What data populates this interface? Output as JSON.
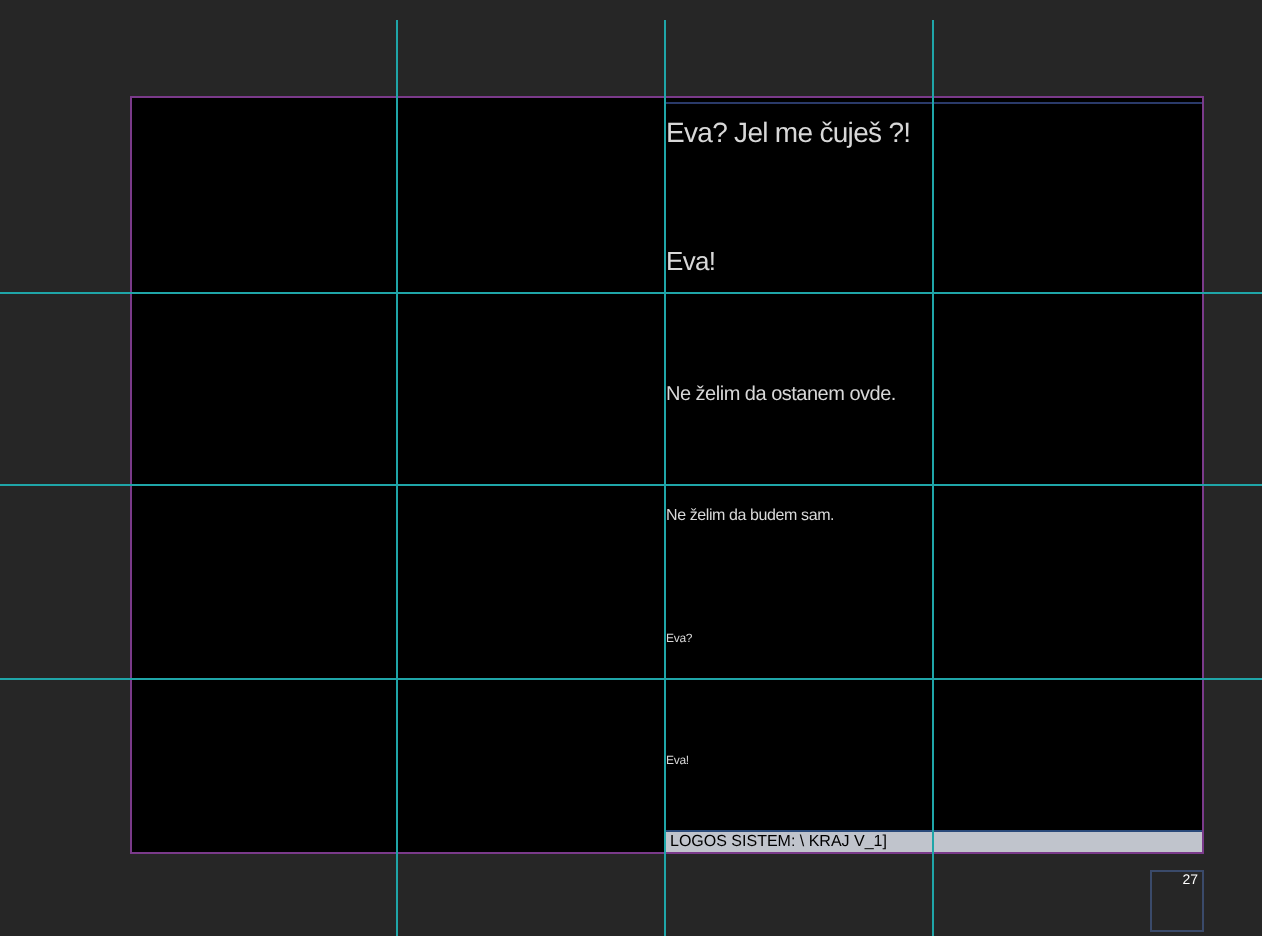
{
  "lines": [
    {
      "text": "Eva? Jel me čuješ ?!"
    },
    {
      "text": "Eva!"
    },
    {
      "text": "Ne želim da ostanem ovde."
    },
    {
      "text": "Ne želim da budem sam."
    },
    {
      "text": "Eva?"
    },
    {
      "text": "Eva!"
    }
  ],
  "status_bar": "LOGOS SISTEM: \\ KRAJ V_1]",
  "page_number": "27"
}
